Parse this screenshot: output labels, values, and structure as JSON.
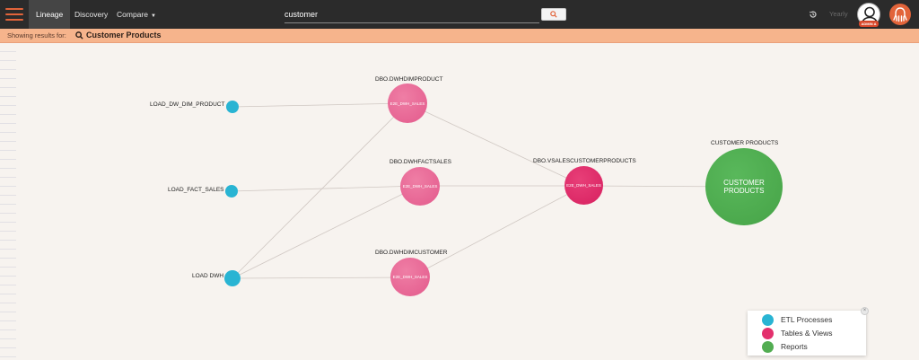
{
  "nav": {
    "items": [
      {
        "label": "Lineage",
        "active": true
      },
      {
        "label": "Discovery",
        "active": false
      },
      {
        "label": "Compare",
        "active": false
      }
    ],
    "compare_caret": "▼"
  },
  "search": {
    "value": "customer"
  },
  "header": {
    "period": "Yearly",
    "user_badge": "ADMIN A"
  },
  "results": {
    "label": "Showing results for:",
    "value": "Customer Products"
  },
  "graph": {
    "etl_nodes": [
      {
        "label": "LOAD_DW_DIM_PRODUCT"
      },
      {
        "label": "LOAD_FACT_SALES"
      },
      {
        "label": "LOAD DWH"
      }
    ],
    "table_nodes": [
      {
        "label": "DBO.DWHDIMPRODUCT",
        "inner": "E2E_DWH_SALES"
      },
      {
        "label": "DBO.DWHFACTSALES",
        "inner": "E2E_DWH_SALES"
      },
      {
        "label": "DBO.DWHDIMCUSTOMER",
        "inner": "E2E_DWH_SALES"
      },
      {
        "label": "DBO.VSALESCUSTOMERPRODUCTS",
        "inner": "E2E_DWH_SALES"
      }
    ],
    "report_node": {
      "label": "CUSTOMER PRODUCTS",
      "inner": "CUSTOMER PRODUCTS"
    }
  },
  "legend": {
    "items": [
      {
        "label": "ETL Processes",
        "color": "#29b4d3"
      },
      {
        "label": "Tables & Views",
        "color": "#e3306d"
      },
      {
        "label": "Reports",
        "color": "#52ad52"
      }
    ]
  },
  "colors": {
    "accent": "#e2643a",
    "results_bar": "#f6b48c",
    "topbar": "#2b2b2b"
  }
}
